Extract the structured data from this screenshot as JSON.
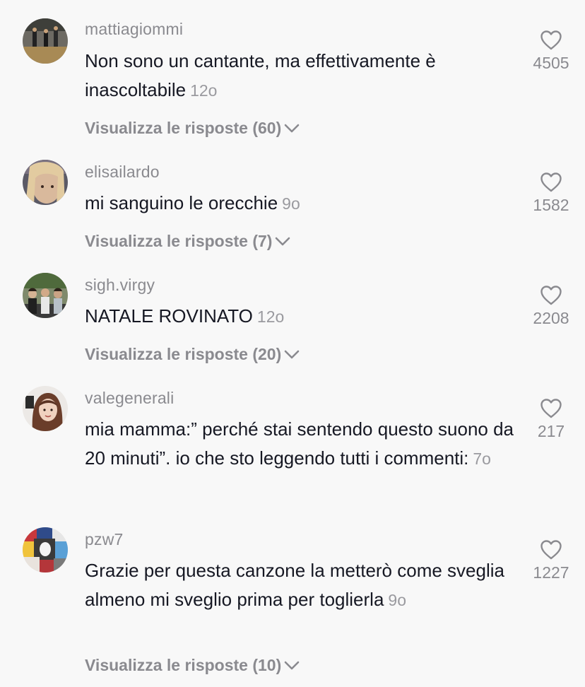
{
  "comments": [
    {
      "username": "mattiagiommi",
      "text": "Non sono un cantante, ma effettivamente è inascoltabile",
      "time": "12o",
      "likes": "4505",
      "replies": "Visualizza le risposte (60)"
    },
    {
      "username": "elisailardo",
      "text": "mi sanguino le orecchie",
      "time": "9o",
      "likes": "1582",
      "replies": "Visualizza le risposte (7)"
    },
    {
      "username": "sigh.virgy",
      "text": "NATALE ROVINATO",
      "time": "12o",
      "likes": "2208",
      "replies": "Visualizza le risposte (20)"
    },
    {
      "username": "valegenerali",
      "text": "mia mamma:” perché stai sentendo questo suono da 20 minuti”. io che sto leggendo tutti i commenti:",
      "time": "7o",
      "likes": "217"
    },
    {
      "username": "pzw7",
      "text": "Grazie per questa canzone la metterò come sveglia almeno mi sveglio prima per toglierla",
      "time": "9o",
      "likes": "1227",
      "replies": "Visualizza le risposte (10)"
    }
  ],
  "icons": {
    "like": "heart-outline-icon",
    "expand": "chevron-down-icon"
  },
  "colors": {
    "background": "#f8f8f8",
    "text": "#161823",
    "secondary": "#8a8a8f"
  }
}
